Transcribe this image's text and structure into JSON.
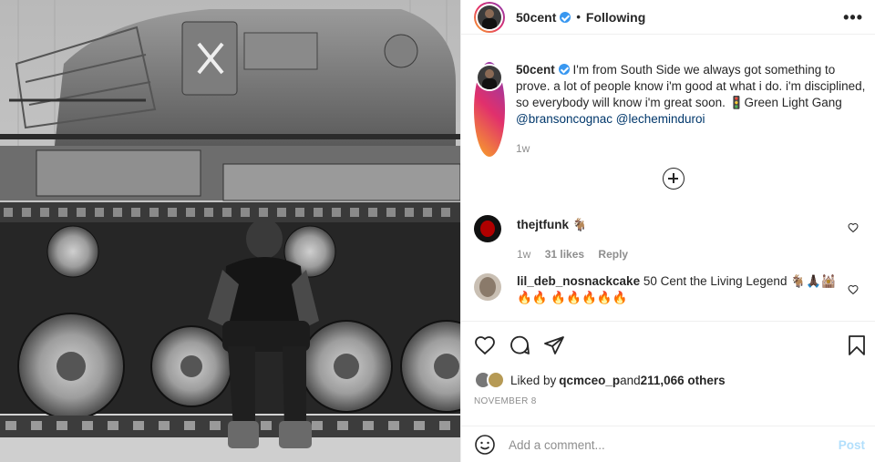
{
  "post": {
    "username": "50cent",
    "follow_status": "Following",
    "header_separator": "•",
    "more_label": "•••"
  },
  "caption": {
    "username": "50cent",
    "text": " I'm from South Side we always got something to prove. a lot of people know i'm good at what i do. i'm disciplined, so everybody will know i'm great soon. 🚦Green Light Gang",
    "mention1": "@bransoncognac",
    "mention2": "@lecheminduroi",
    "time": "1w"
  },
  "comments": [
    {
      "username": "thejtfunk",
      "text": " 🐐",
      "time": "1w",
      "likes": "31 likes",
      "reply": "Reply",
      "avatar_color": "#b00000"
    },
    {
      "username": "lil_deb_nosnackcake",
      "text": " 50 Cent the Living Legend 🐐🙏🏿🕍🔥🔥 🔥🔥🔥🔥🔥",
      "avatar_color": "#8a7a6a"
    }
  ],
  "likes": {
    "prefix": "Liked by ",
    "user": "qcmceo_p",
    "middle": " and ",
    "count": "211,066 others"
  },
  "date": "NOVEMBER 8",
  "add_comment": {
    "placeholder": "Add a comment...",
    "post_label": "Post"
  },
  "colors": {
    "link": "#00376b",
    "muted": "#8e8e8e",
    "verified": "#3897f0",
    "post_disabled": "#b2dffc"
  }
}
